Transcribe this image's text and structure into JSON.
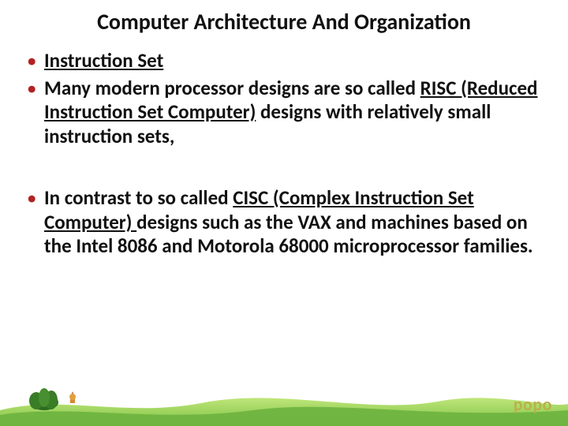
{
  "title": "Computer Architecture And Organization",
  "bul": {
    "b1_u": "Instruction Set",
    "b2_pre": "Many modern processor designs are so called ",
    "b2_u": "RISC (Reduced Instruction Set Computer)",
    "b2_post": " designs with relatively small instruction sets,",
    "b3_pre": "In contrast to so called ",
    "b3_u": "CISC (Complex Instruction Set Computer) ",
    "b3_post": "designs such as the VAX and machines based on the Intel 8086 and Motorola 68000 microprocessor families."
  },
  "watermark": "popo"
}
